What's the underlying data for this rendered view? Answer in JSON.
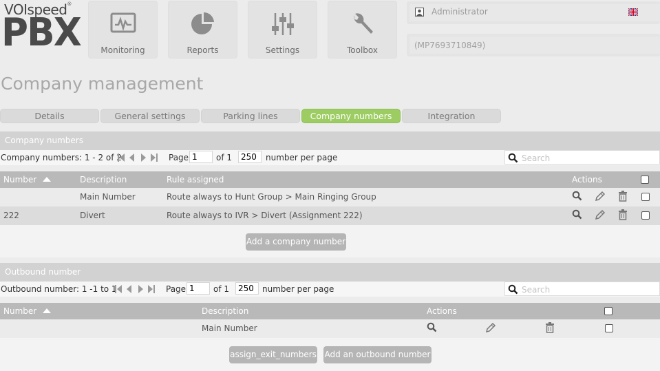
{
  "logo": {
    "brand": "VOIspeed",
    "product": "PBX"
  },
  "nav": [
    {
      "label": "Monitoring",
      "icon": "monitoring-icon"
    },
    {
      "label": "Reports",
      "icon": "pie-chart-icon"
    },
    {
      "label": "Settings",
      "icon": "sliders-icon"
    },
    {
      "label": "Toolbox",
      "icon": "wrench-icon"
    }
  ],
  "user": {
    "name": "Administrator",
    "account": "(MP7693710849)",
    "language_icon": "uk-flag-icon"
  },
  "page_title": "Company management",
  "tabs": [
    {
      "label": "Details",
      "active": false
    },
    {
      "label": "General settings",
      "active": false
    },
    {
      "label": "Parking lines",
      "active": false
    },
    {
      "label": "Company numbers",
      "active": true
    },
    {
      "label": "Integration",
      "active": false
    }
  ],
  "company_numbers": {
    "section_title": "Company numbers",
    "range_text": "Company numbers: 1 - 2 of 2",
    "page_label": "Page",
    "page_value": "1",
    "of_text": "of 1",
    "per_page_value": "250",
    "per_page_label": "number per page",
    "search_placeholder": "Search",
    "headers": {
      "number": "Number",
      "description": "Description",
      "rule": "Rule assigned",
      "actions": "Actions"
    },
    "rows": [
      {
        "number": "",
        "description": "Main Number",
        "rule": "Route always to Hunt Group > Main Ringing Group"
      },
      {
        "number": "222",
        "description": "Divert",
        "rule": "Route always to IVR > Divert (Assignment 222)"
      }
    ],
    "add_button": "Add a company number"
  },
  "outbound_numbers": {
    "section_title": "Outbound number",
    "range_text": "Outbound number: 1 -1 to 1",
    "page_label": "Page",
    "page_value": "1",
    "of_text": "of 1",
    "per_page_value": "250",
    "per_page_label": "number per page",
    "search_placeholder": "Search",
    "headers": {
      "number": "Number",
      "description": "Description",
      "actions": "Actions"
    },
    "rows": [
      {
        "number": "",
        "description": "Main Number"
      }
    ],
    "assign_button": "assign_exit_numbers",
    "add_button": "Add an outbound number"
  },
  "colors": {
    "accent_green": "#9ccc62",
    "section_bg": "#d2d2d2",
    "header_bg": "#b9b9b9",
    "button_bg": "#b5b5b5"
  }
}
